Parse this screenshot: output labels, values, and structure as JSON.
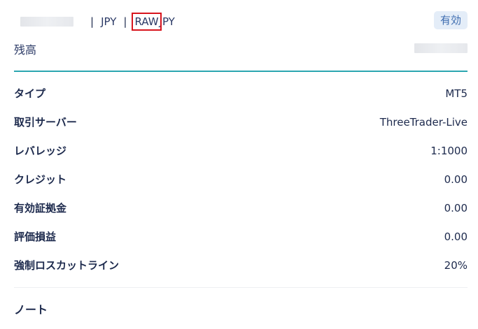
{
  "account": {
    "currency": "JPY",
    "type_prefix": "RAW",
    "type_suffix": "JPY",
    "separator": "|",
    "status": "有効"
  },
  "balance": {
    "label": "残高"
  },
  "details": [
    {
      "label": "タイプ",
      "value": "MT5"
    },
    {
      "label": "取引サーバー",
      "value": "ThreeTrader-Live"
    },
    {
      "label": "レバレッジ",
      "value": "1:1000"
    },
    {
      "label": "クレジット",
      "value": "0.00"
    },
    {
      "label": "有効証拠金",
      "value": "0.00"
    },
    {
      "label": "評価損益",
      "value": "0.00"
    },
    {
      "label": "強制ロスカットライン",
      "value": "20%"
    }
  ],
  "note": {
    "label": "ノート"
  },
  "colors": {
    "accent_divider": "#2ba6b0",
    "highlight_box": "#d8141d",
    "badge_bg": "#e4edf8",
    "badge_text": "#3e6db0"
  }
}
